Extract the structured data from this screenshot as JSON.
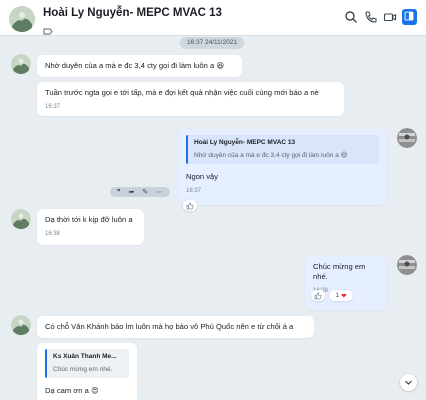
{
  "colors": {
    "accent": "#1a73e8",
    "sent_bubble": "#e5efff",
    "received_bubble": "#ffffff",
    "background": "#e8edf2",
    "heart": "#e02b3f"
  },
  "header": {
    "title": "Hoài Ly Nguyễn- MEPC MVAC 13",
    "icons": [
      "search-icon",
      "phone-icon",
      "video-call-icon",
      "sidebar-toggle-icon"
    ]
  },
  "conversation": {
    "date_separator": "16:37 24/11/2021",
    "messages": [
      {
        "text": "Nhờ duyên của a mà e đc 3,4 cty gọi đi làm luôn a",
        "emoji": "😆"
      },
      {
        "text": "Tuần trước ngta gọi e tới tấp, mà e đợi kết quả nhận việc cuối cùng mới báo a nè",
        "time": "16:37"
      },
      {
        "quote_name": "Hoài Ly Nguyễn- MEPC MVAC 13",
        "quote_text": "Nhờ duyên của a mà e đc 3,4 cty gọi đi làm luôn a",
        "quote_emoji": "😆",
        "text": "Ngon vậy",
        "time": "16:37"
      },
      {
        "text": "Dạ thời tới k kịp đỡ luôn a",
        "time": "16:38"
      },
      {
        "text": "Chúc mừng em nhé.",
        "time": "16:38",
        "reaction_count": "1",
        "reaction_emoji": "❤"
      },
      {
        "text": "Có chỗ Văn Khánh bảo lm luôn mà họ bảo vô Phú Quốc nên e từ chối á a"
      },
      {
        "quote_name": "Ks Xuân Thanh Me...",
        "quote_text": "Chúc mừng em nhé.",
        "text": "Dạ cam ơn a",
        "emoji": "😍"
      }
    ],
    "hover_actions": [
      "quote-icon",
      "share-icon",
      "edit-icon",
      "more-icon"
    ]
  }
}
